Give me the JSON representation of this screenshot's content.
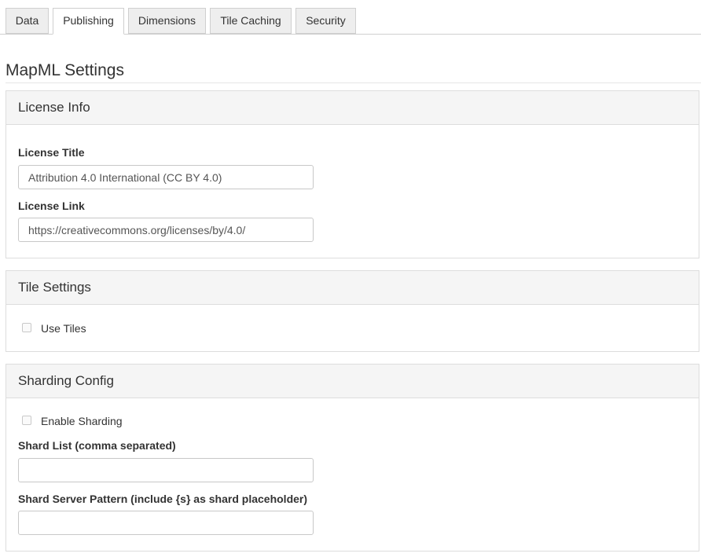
{
  "tabs": [
    {
      "label": "Data",
      "active": false
    },
    {
      "label": "Publishing",
      "active": true
    },
    {
      "label": "Dimensions",
      "active": false
    },
    {
      "label": "Tile Caching",
      "active": false
    },
    {
      "label": "Security",
      "active": false
    }
  ],
  "section_title": "MapML Settings",
  "license_panel": {
    "heading": "License Info",
    "title_label": "License Title",
    "title_value": "Attribution 4.0 International (CC BY 4.0)",
    "link_label": "License Link",
    "link_value": "https://creativecommons.org/licenses/by/4.0/"
  },
  "tile_panel": {
    "heading": "Tile Settings",
    "use_tiles_label": "Use Tiles",
    "use_tiles_checked": false
  },
  "sharding_panel": {
    "heading": "Sharding Config",
    "enable_label": "Enable Sharding",
    "enable_checked": false,
    "shard_list_label": "Shard List (comma separated)",
    "shard_list_value": "",
    "shard_pattern_label": "Shard Server Pattern (include {s} as shard placeholder)",
    "shard_pattern_value": ""
  }
}
